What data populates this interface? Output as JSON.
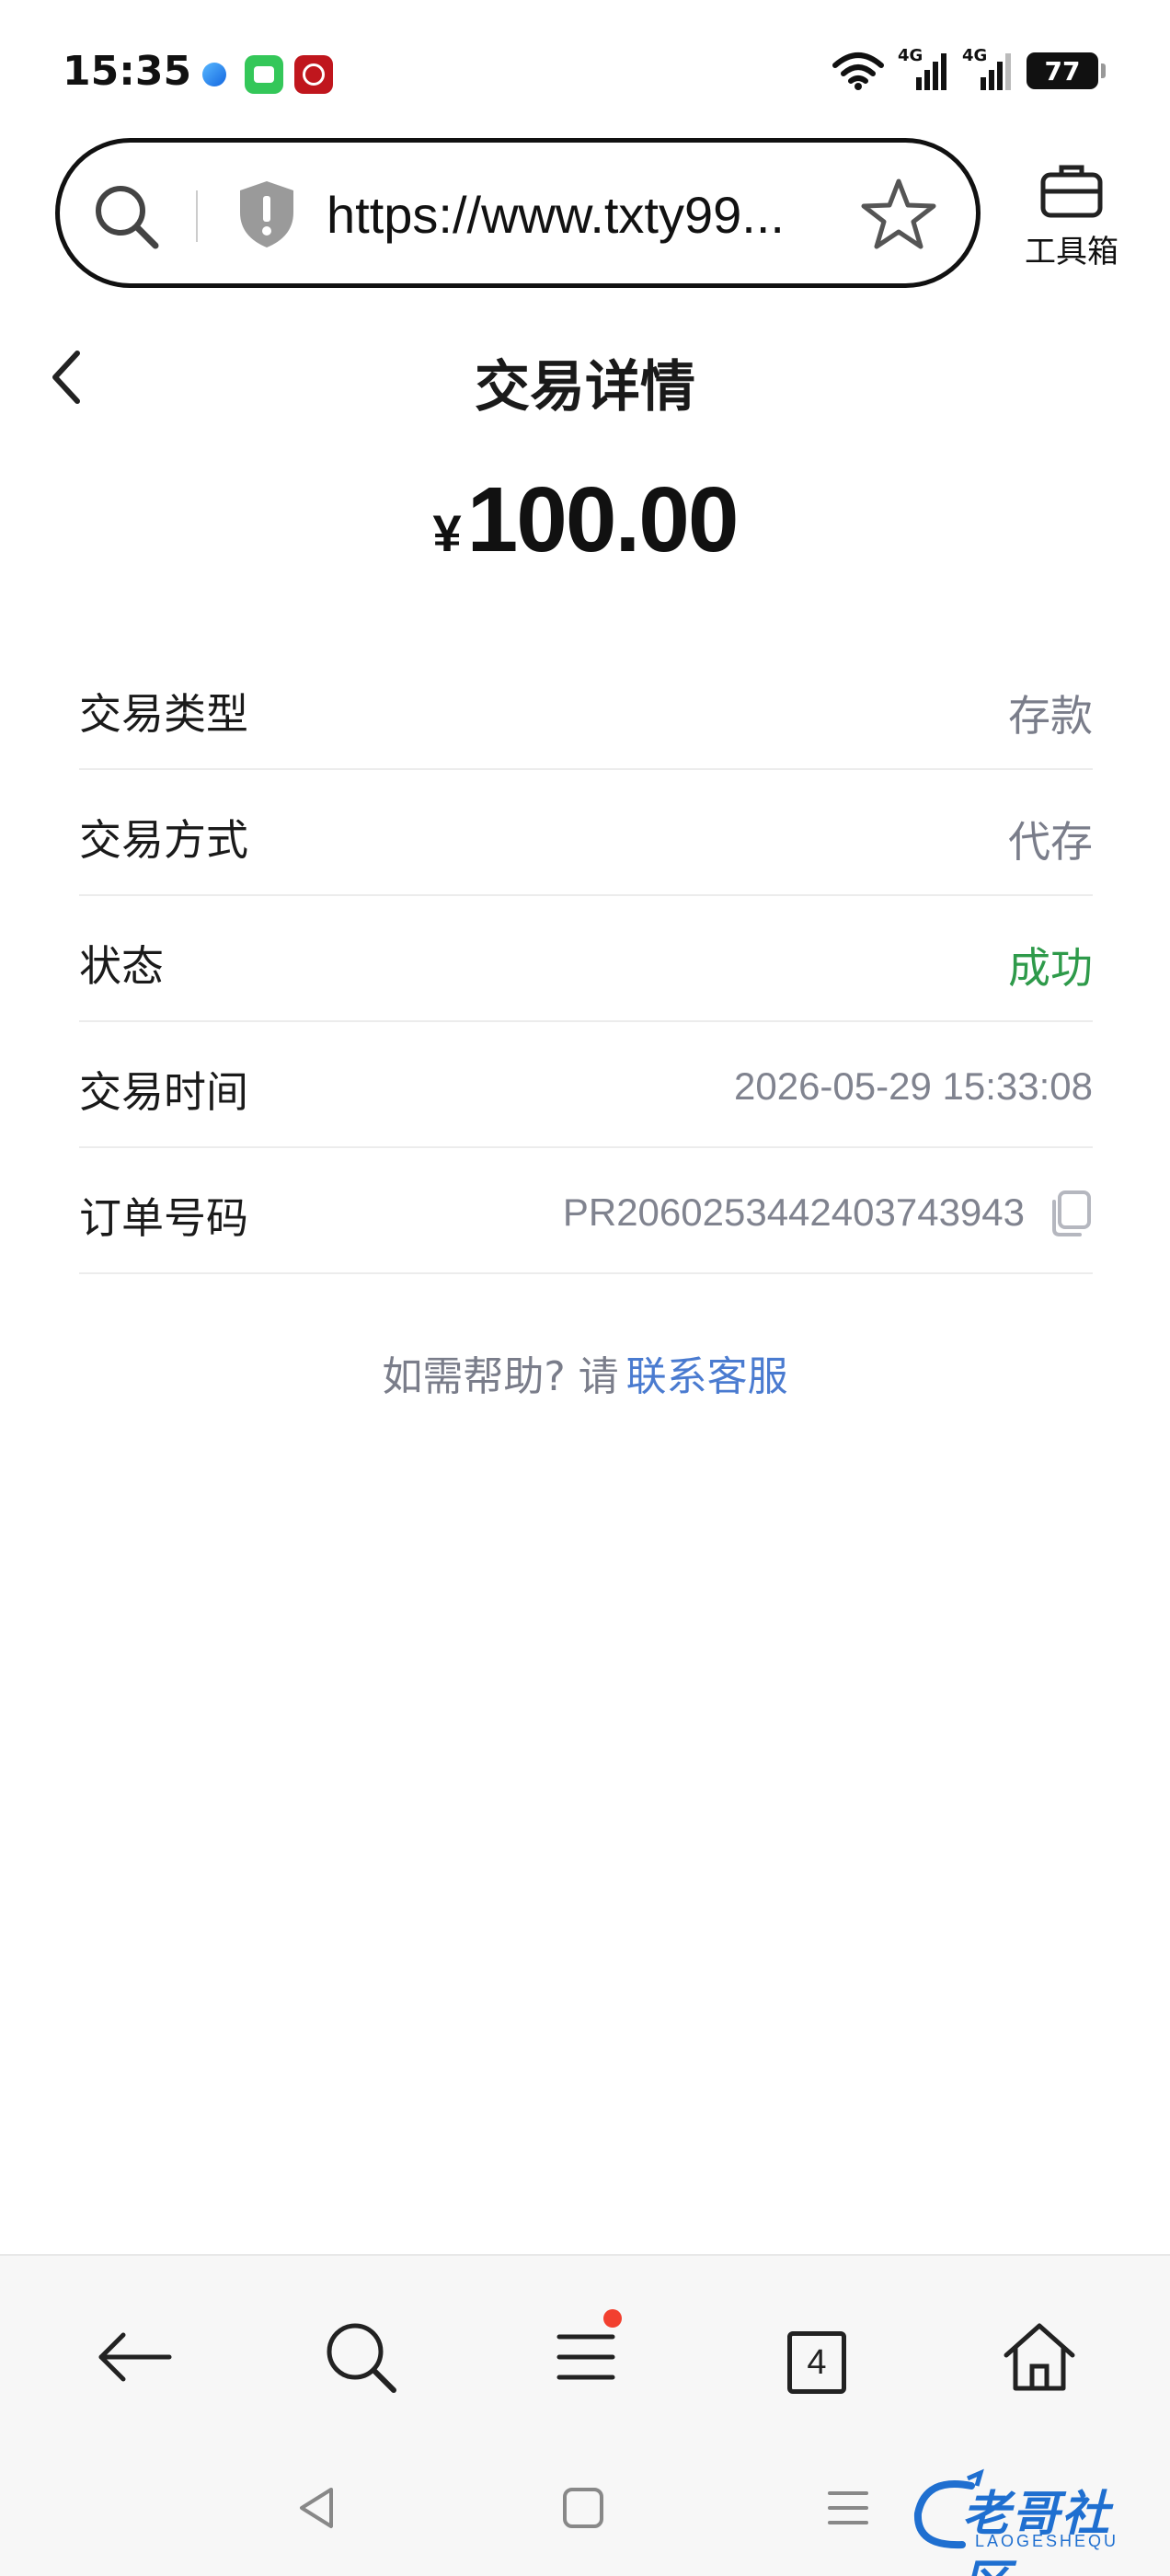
{
  "status_bar": {
    "time": "15:35",
    "battery": "77",
    "network_a": "4G",
    "network_b": "4G"
  },
  "browser": {
    "url": "https://www.txty99...",
    "toolbox_label": "工具箱"
  },
  "header": {
    "title": "交易详情"
  },
  "amount": {
    "currency": "¥",
    "value": "100.00"
  },
  "details": [
    {
      "label": "交易类型",
      "value": "存款"
    },
    {
      "label": "交易方式",
      "value": "代存"
    },
    {
      "label": "状态",
      "value": "成功",
      "status_color": "#2e9a4a"
    },
    {
      "label": "交易时间",
      "value": "2026-05-29 15:33:08"
    },
    {
      "label": "订单号码",
      "value": "PR2060253442403743943"
    }
  ],
  "help": {
    "text": "如需帮助? 请",
    "link": "联系客服",
    "link_color": "#4a7bd0"
  },
  "bottom_nav": {
    "tab_count": "4"
  },
  "watermark": {
    "text": "老哥社区",
    "sub": "LAOGESHEQU"
  }
}
